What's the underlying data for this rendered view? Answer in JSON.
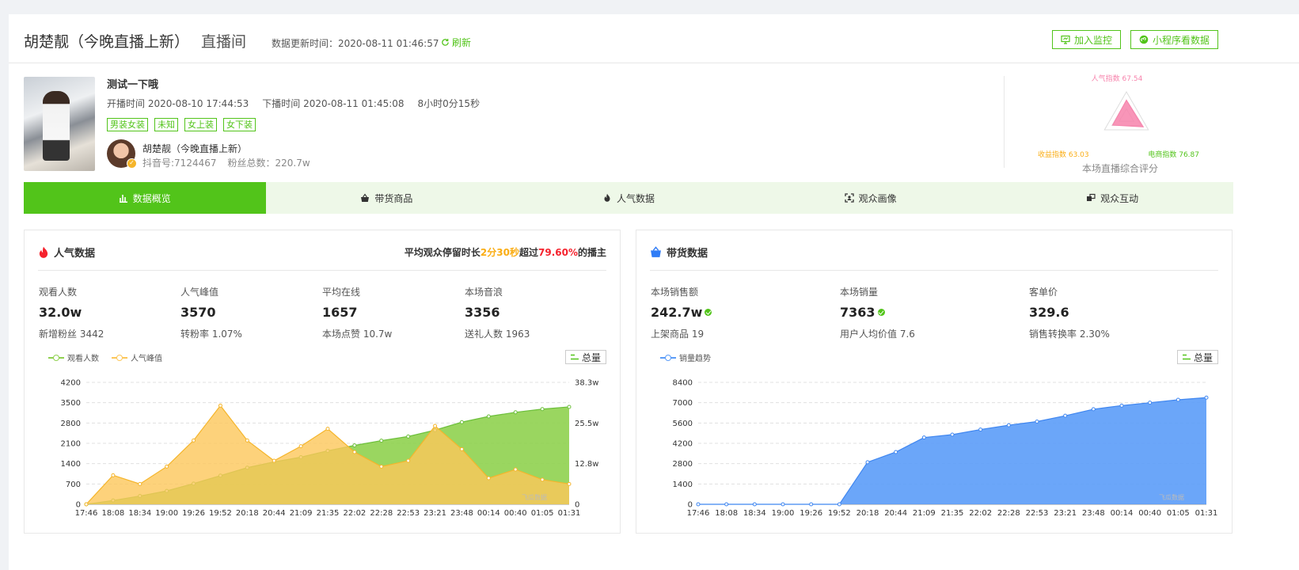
{
  "header": {
    "title": "胡楚靓（今晚直播上新）",
    "subtitle": "直播间",
    "update_label": "数据更新时间：",
    "update_time": "2020-08-11 01:46:57",
    "refresh_label": "刷新",
    "monitor_label": "加入监控",
    "miniprogram_label": "小程序看数据"
  },
  "stream": {
    "title": "测试一下哦",
    "start": "开播时间 2020-08-10 17:44:53",
    "end": "下播时间 2020-08-11 01:45:08",
    "duration": "8小时0分15秒",
    "tags": [
      "男装女装",
      "未知",
      "女上装",
      "女下装"
    ],
    "host_name": "胡楚靓（今晚直播上新）",
    "douyin_id": "抖音号:7124467",
    "fans": "粉丝总数：220.7w"
  },
  "radar": {
    "labels": [
      {
        "name": "人气指数 67.54",
        "value": 67.54,
        "color": "#f783ac"
      },
      {
        "name": "电商指数 76.87",
        "value": 76.87,
        "color": "#52c41a"
      },
      {
        "name": "收益指数 63.03",
        "value": 63.03,
        "color": "#faad14"
      }
    ],
    "caption": "本场直播综合评分",
    "fill": "#f783ac"
  },
  "tabs": [
    {
      "label": "数据概览",
      "icon": "bar-chart-icon",
      "active": true
    },
    {
      "label": "带货商品",
      "icon": "basket-icon",
      "active": false
    },
    {
      "label": "人气数据",
      "icon": "fire-icon",
      "active": false
    },
    {
      "label": "观众画像",
      "icon": "portrait-icon",
      "active": false
    },
    {
      "label": "观众互动",
      "icon": "interaction-icon",
      "active": false
    }
  ],
  "popularity": {
    "title": "人气数据",
    "note_prefix": "平均观众停留时长",
    "note_time": "2分30秒",
    "note_mid": "超过",
    "note_pct": "79.60%",
    "note_suffix": "的播主",
    "metrics": [
      {
        "label": "观看人数",
        "value": "32.0w",
        "sub": "新增粉丝 3442"
      },
      {
        "label": "人气峰值",
        "value": "3570",
        "sub": "转粉率 1.07%"
      },
      {
        "label": "平均在线",
        "value": "1657",
        "sub": "本场点赞 10.7w"
      },
      {
        "label": "本场音浪",
        "value": "3356",
        "sub": "送礼人数 1963"
      }
    ],
    "legend": [
      "观看人数",
      "人气峰值"
    ],
    "total_label": "总量",
    "watermark": "飞瓜数据"
  },
  "sales": {
    "title": "带货数据",
    "metrics": [
      {
        "label": "本场销售额",
        "value": "242.7w",
        "sub": "上架商品 19",
        "verified": true
      },
      {
        "label": "本场销量",
        "value": "7363",
        "sub": "用户人均价值 7.6",
        "verified": true
      },
      {
        "label": "客单价",
        "value": "329.6",
        "sub": "销售转换率 2.30%",
        "verified": false
      }
    ],
    "legend": [
      "销量趋势"
    ],
    "total_label": "总量",
    "watermark": "飞瓜数据"
  },
  "colors": {
    "accent": "#52c41a",
    "green_area": "#8fd14f",
    "orange_area": "#fcc75a",
    "blue_area": "#5b9cf8"
  },
  "chart_data": [
    {
      "type": "area",
      "x": [
        "17:46",
        "18:08",
        "18:34",
        "19:00",
        "19:26",
        "19:52",
        "20:18",
        "20:44",
        "21:09",
        "21:35",
        "22:02",
        "22:28",
        "22:53",
        "23:21",
        "23:48",
        "00:14",
        "00:40",
        "01:05",
        "01:31"
      ],
      "series": [
        {
          "name": "人气峰值",
          "axis": "left",
          "values": [
            0,
            1000,
            700,
            1300,
            2200,
            3400,
            2200,
            1500,
            2000,
            2600,
            1800,
            1300,
            1500,
            2700,
            1900,
            900,
            1200,
            850,
            700
          ]
        },
        {
          "name": "观看人数",
          "axis": "right",
          "values": [
            0,
            1.2,
            2.6,
            4.2,
            6.5,
            9.0,
            11.5,
            13.3,
            14.8,
            16.8,
            18.5,
            20.0,
            21.3,
            23.3,
            25.8,
            27.6,
            28.9,
            29.9,
            30.6
          ]
        }
      ],
      "yticks_left": [
        0,
        700,
        1400,
        2100,
        2800,
        3500,
        4200
      ],
      "ylim_left": [
        0,
        4200
      ],
      "yticks_right": [
        "0",
        "12.8w",
        "25.5w",
        "38.3w"
      ],
      "ylim_right": [
        0,
        38.3
      ],
      "grid": true
    },
    {
      "type": "area",
      "x": [
        "17:46",
        "18:08",
        "18:34",
        "19:00",
        "19:26",
        "19:52",
        "20:18",
        "20:44",
        "21:09",
        "21:35",
        "22:02",
        "22:28",
        "22:53",
        "23:21",
        "23:48",
        "00:14",
        "00:40",
        "01:05",
        "01:31"
      ],
      "series": [
        {
          "name": "销量趋势",
          "values": [
            0,
            0,
            0,
            0,
            0,
            0,
            2900,
            3600,
            4600,
            4800,
            5150,
            5450,
            5700,
            6100,
            6550,
            6800,
            7000,
            7200,
            7350
          ]
        }
      ],
      "yticks": [
        0,
        1400,
        2800,
        4200,
        5600,
        7000,
        8400
      ],
      "ylim": [
        0,
        8400
      ],
      "grid": true
    }
  ]
}
